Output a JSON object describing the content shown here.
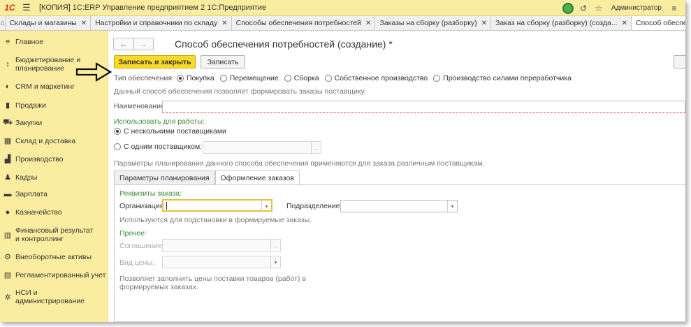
{
  "titlebar": {
    "logo": "1С",
    "app_title": "[КОПИЯ] 1С:ERP Управление предприятием 2 1С:Предприятие",
    "user": "Администратор"
  },
  "tabs": [
    {
      "label": "Склады и магазины",
      "active": false
    },
    {
      "label": "Настройки и справочники по складу",
      "active": false
    },
    {
      "label": "Способы обеспечения потребностей",
      "active": false
    },
    {
      "label": "Заказы на сборку (разборку)",
      "active": false
    },
    {
      "label": "Заказ на сборку (разборку) (созда...",
      "active": false
    },
    {
      "label": "Способ обеспечения потребн",
      "active": true
    }
  ],
  "sidebar": {
    "items": [
      {
        "label": "Главное",
        "icon": "menu-icon"
      },
      {
        "label": "Бюджетирование и планирование",
        "icon": "budget-icon"
      },
      {
        "label": "CRM и маркетинг",
        "icon": "crm-icon"
      },
      {
        "label": "Продажи",
        "icon": "sales-icon"
      },
      {
        "label": "Закупки",
        "icon": "cart-icon"
      },
      {
        "label": "Склад и доставка",
        "icon": "warehouse-icon"
      },
      {
        "label": "Производство",
        "icon": "factory-icon"
      },
      {
        "label": "Кадры",
        "icon": "person-icon"
      },
      {
        "label": "Зарплата",
        "icon": "money-icon"
      },
      {
        "label": "Казначейство",
        "icon": "treasury-icon"
      },
      {
        "label": "Финансовый результат и контроллинг",
        "icon": "chart-icon"
      },
      {
        "label": "Внеоборотные активы",
        "icon": "assets-icon"
      },
      {
        "label": "Регламентированный учет",
        "icon": "ledger-icon"
      },
      {
        "label": "НСИ и администрирование",
        "icon": "gear-icon"
      }
    ]
  },
  "form": {
    "title": "Способ обеспечения потребностей (создание) *",
    "save_close_label": "Записать и закрыть",
    "save_label": "Записать",
    "supply_type_label": "Тип обеспечения:",
    "supply_types": [
      "Покупка",
      "Перемещение",
      "Сборка",
      "Собственное производство",
      "Производство силами переработчика"
    ],
    "supply_type_selected": "Покупка",
    "supply_hint": "Данный способ обеспечения позволяет формировать заказы поставщику.",
    "name_label": "Наименование:",
    "name_value": "",
    "use_for_work_label": "Использовать для работы:",
    "multi_suppliers_label": "С несколькими поставщиками",
    "one_supplier_label": "С одним поставщиком:",
    "one_supplier_value": "",
    "planning_hint": "Параметры планирования данного способа обеспечения применяются для заказа различным поставщикам.",
    "inner_tabs": [
      "Параметры планирования",
      "Оформление заказов"
    ],
    "active_inner_tab": "Оформление заказов",
    "order_details_label": "Реквизиты заказа:",
    "organization_label": "Организация:",
    "organization_value": "",
    "division_label": "Подразделение:",
    "division_value": "",
    "substitution_hint": "Используются для подстановки в формируемые заказы.",
    "other_label": "Прочее:",
    "agreement_label": "Соглашение:",
    "price_type_label": "Вид цены:",
    "price_hint_line1": "Позволяет заполнить цены поставки товаров (работ) в",
    "price_hint_line2": "формируемых заказах."
  }
}
